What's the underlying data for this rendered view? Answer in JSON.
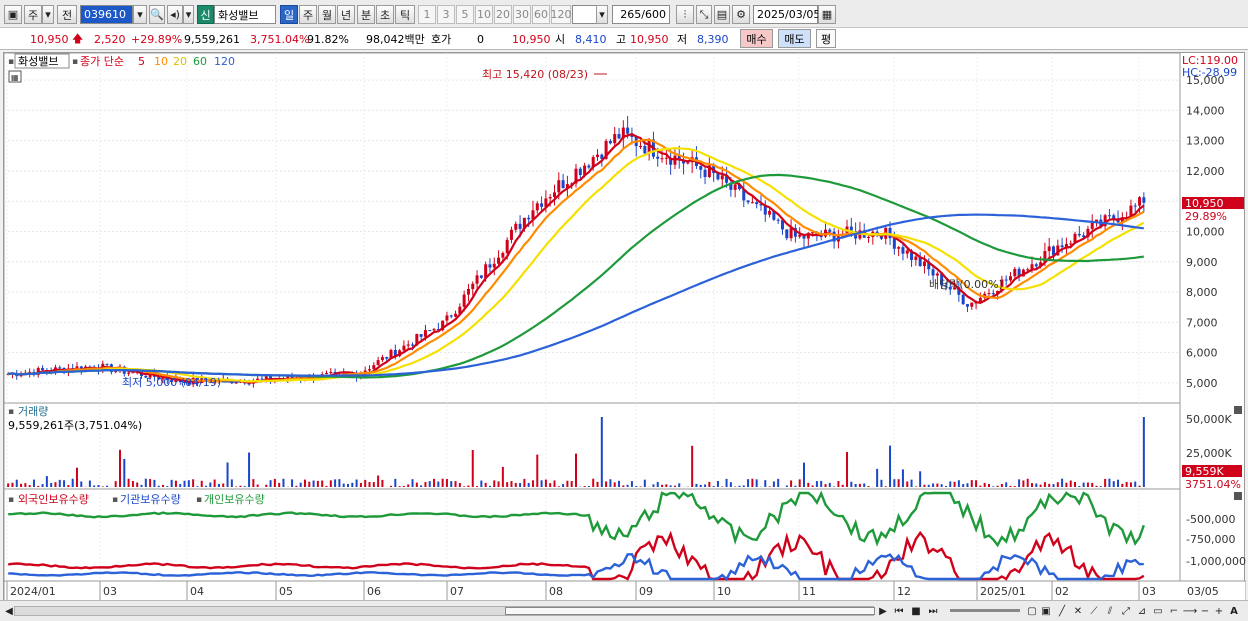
{
  "toolbar": {
    "type_label": "주",
    "prev_label": "전",
    "code": "039610",
    "new_badge": "신",
    "stock_name": "화성밸브",
    "period_tabs": [
      "일",
      "주",
      "월",
      "년",
      "분",
      "초",
      "틱"
    ],
    "active_period": "일",
    "interval_buttons": [
      "1",
      "3",
      "5",
      "10",
      "20",
      "30",
      "60",
      "120"
    ],
    "count": "265",
    "count_total": "/600",
    "date": "2025/03/05"
  },
  "quote": {
    "price": "10,950",
    "change": "2,520",
    "change_pct": "+29.89%",
    "volume": "9,559,261",
    "volume_ratio": "3,751.04%",
    "turnover": "91.82%",
    "amount": "98,042백만",
    "hoga_label": "호가",
    "hoga_value": "0",
    "hoga_price": "10,950",
    "open_label": "시",
    "open": "8,410",
    "high_label": "고",
    "high": "10,950",
    "low_label": "저",
    "low": "8,390",
    "buy_label": "매수",
    "sell_label": "매도",
    "eval_label": "평"
  },
  "legend": {
    "name": "화성밸브",
    "ma_title": "종가 단순",
    "ma_periods": [
      "5",
      "10",
      "20",
      "60",
      "120"
    ],
    "lc": "LC:119.00",
    "hc": "HC:-28.99"
  },
  "annotations": {
    "high_note": "최고 15,420 (08/23)",
    "low_note": "최저 5,000 (04/19)",
    "dividend_note": "배당락(0.00%)",
    "price_tag": "10,950",
    "pct_tag": "29.89%",
    "vol_tag": "9,559K",
    "volr_tag": "3751.04%"
  },
  "volume_panel": {
    "title": "거래량",
    "value": "9,559,261주(3,751.04%)",
    "axis": [
      "50,000K",
      "25,000K"
    ]
  },
  "holdings_panel": {
    "labels": [
      "외국인보유수량",
      "기관보유수량",
      "개인보유수량"
    ],
    "axis": [
      "-500,000",
      "-750,000",
      "-1,000,000"
    ]
  },
  "price_axis": [
    "15,000",
    "14,000",
    "13,000",
    "12,000",
    "11,000",
    "10,000",
    "9,000",
    "8,000",
    "7,000",
    "6,000",
    "5,000"
  ],
  "x_axis": [
    "2024/01",
    "03",
    "04",
    "05",
    "06",
    "07",
    "08",
    "09",
    "10",
    "11",
    "12",
    "2025/01",
    "02",
    "03",
    "03/05"
  ],
  "colors": {
    "up": "#d0021b",
    "down": "#1a47c9",
    "ma5": "#d0021b",
    "ma10": "#ff8c00",
    "ma20": "#f5e000",
    "ma60": "#1f9a3a",
    "ma120": "#2c62d8"
  },
  "chart_data": {
    "type": "line",
    "title": "화성밸브",
    "series": [
      {
        "name": "종가",
        "x": [
          "2024/01",
          "03",
          "04",
          "05",
          "06",
          "07",
          "08",
          "09",
          "10",
          "11",
          "12",
          "2025/01",
          "02",
          "03"
        ],
        "values": [
          5300,
          5550,
          5050,
          5100,
          5300,
          7000,
          10800,
          13200,
          12000,
          9800,
          10000,
          7600,
          9500,
          10950
        ]
      },
      {
        "name": "60",
        "x": [
          "2024/01",
          "03",
          "04",
          "05",
          "06",
          "07",
          "08",
          "09",
          "10",
          "11",
          "12",
          "2025/01",
          "02",
          "03"
        ],
        "values": [
          5300,
          5450,
          5400,
          5250,
          5250,
          6400,
          7800,
          9700,
          11400,
          11700,
          11300,
          9200,
          8800,
          8700
        ]
      },
      {
        "name": "120",
        "x": [
          "2024/01",
          "03",
          "04",
          "05",
          "06",
          "07",
          "08",
          "09",
          "10",
          "11",
          "12",
          "2025/01",
          "02",
          "03"
        ],
        "values": [
          5350,
          5350,
          5350,
          5300,
          5300,
          5900,
          6800,
          8200,
          9400,
          10200,
          10400,
          10400,
          10300,
          9800
        ]
      }
    ],
    "ylim": [
      4500,
      15500
    ]
  }
}
